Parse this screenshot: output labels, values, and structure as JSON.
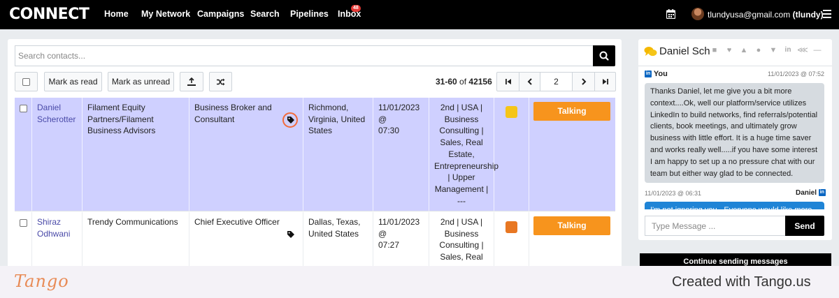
{
  "nav": {
    "logo": "CONNECT",
    "items": [
      "Home",
      "My Network",
      "Campaigns",
      "Search",
      "Pipelines",
      "Inbox"
    ],
    "inbox_badge": "48",
    "user_email": "tlundyusa@gmail.com",
    "user_handle": "(tlundy)"
  },
  "search": {
    "placeholder": "Search contacts..."
  },
  "toolbar": {
    "mark_read": "Mark as read",
    "mark_unread": "Mark as unread",
    "range": "31-60",
    "of": "of",
    "total": "42156",
    "page": "2"
  },
  "rows": [
    {
      "name_line1": "Daniel",
      "name_line2": "Scherotter",
      "company": "Filament Equity Partners/Filament Business Advisors",
      "title": "Business Broker and Consultant",
      "location": "Richmond, Virginia, United States",
      "time_line1": "11/01/2023 @",
      "time_line2": "07:30",
      "category": "2nd | USA | Business Consulting | Sales, Real Estate, Entrepreneurship | Upper Management | ---",
      "color": "#f5c518",
      "status": "Talking"
    },
    {
      "name_line1": "Shiraz",
      "name_line2": "Odhwani",
      "company": "Trendy Communications",
      "title": "Chief Executive Officer",
      "location": "Dallas, Texas, United States",
      "time_line1": "11/01/2023 @",
      "time_line2": "07:27",
      "category": "2nd | USA | Business Consulting | Sales, Real",
      "color": "#e87722",
      "status": "Talking"
    }
  ],
  "chat": {
    "title": "Daniel Scherotter",
    "msg1_from": "You",
    "msg1_time": "11/01/2023 @ 07:52",
    "msg1_text": "Thanks Daniel, let me give you a bit more context....Ok, well our platform/service utilizes LinkedIn to build networks, find referrals/potential clients, book meetings, and ultimately grow business with little effort. It is a huge time saver and works really well.....if you have some interest I am happy to set up a no pressure chat with our team but either way glad to be connected.",
    "msg2_time": "11/01/2023 @ 06:31",
    "msg2_from": "Daniel",
    "msg2_text": "I'm not ignoring you - Everyone would like more",
    "input_placeholder": "Type Message ...",
    "send": "Send",
    "continue": "Continue sending messages"
  },
  "colors": {
    "status_orange": "#f7941d",
    "nav_bg": "#000000",
    "link_purple": "#4a4aa8"
  },
  "footer": {
    "brand": "Tango",
    "created_with": "Created with Tango.us"
  }
}
